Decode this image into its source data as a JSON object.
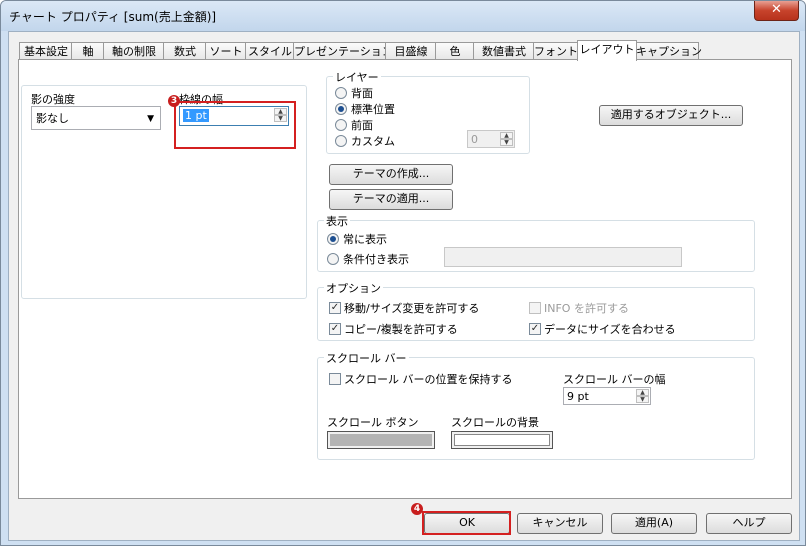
{
  "window": {
    "title": "チャート プロパティ [sum(売上金額)]",
    "close_label": "✕"
  },
  "tabs": [
    "基本設定",
    "軸",
    "軸の制限",
    "数式",
    "ソート",
    "スタイル",
    "プレゼンテーション",
    "目盛線",
    "色",
    "数値書式",
    "フォント",
    "レイアウト",
    "キャプション"
  ],
  "active_tab": "レイアウト",
  "shadow": {
    "label": "影の強度",
    "value": "影なし"
  },
  "border_width": {
    "label": "枠線の幅",
    "value": "1 pt",
    "marker": "3"
  },
  "apply_to_objects": {
    "label": "適用するオブジェクト..."
  },
  "layer": {
    "legend": "レイヤー",
    "options": [
      "背面",
      "標準位置",
      "前面",
      "カスタム"
    ],
    "selected": "標準位置",
    "custom_value": "0"
  },
  "theme": {
    "create_label": "テーマの作成...",
    "apply_label": "テーマの適用..."
  },
  "display": {
    "legend": "表示",
    "options": [
      "常に表示",
      "条件付き表示"
    ],
    "selected": "常に表示",
    "condition_value": ""
  },
  "options": {
    "legend": "オプション",
    "allow_move_resize": {
      "label": "移動/サイズ変更を許可する",
      "checked": true
    },
    "allow_info": {
      "label": "INFO を許可する",
      "checked": false,
      "disabled": true
    },
    "allow_copy": {
      "label": "コピー/複製を許可する",
      "checked": true
    },
    "fit_to_data": {
      "label": "データにサイズを合わせる",
      "checked": true
    }
  },
  "scrollbar": {
    "legend": "スクロール バー",
    "keep_position": {
      "label": "スクロール バーの位置を保持する",
      "checked": false
    },
    "width_label": "スクロール バーの幅",
    "width_value": "9 pt",
    "button_label": "スクロール ボタン",
    "background_label": "スクロールの背景",
    "button_color": "#b4b4b4",
    "background_color": "#ffffff"
  },
  "footer": {
    "ok": "OK",
    "cancel": "キャンセル",
    "apply": "適用(A)",
    "help": "ヘルプ",
    "marker": "4"
  },
  "colors": {
    "highlight_red": "#d42020",
    "selection_blue": "#3399ff",
    "window_frame": "#cfe0f2"
  }
}
